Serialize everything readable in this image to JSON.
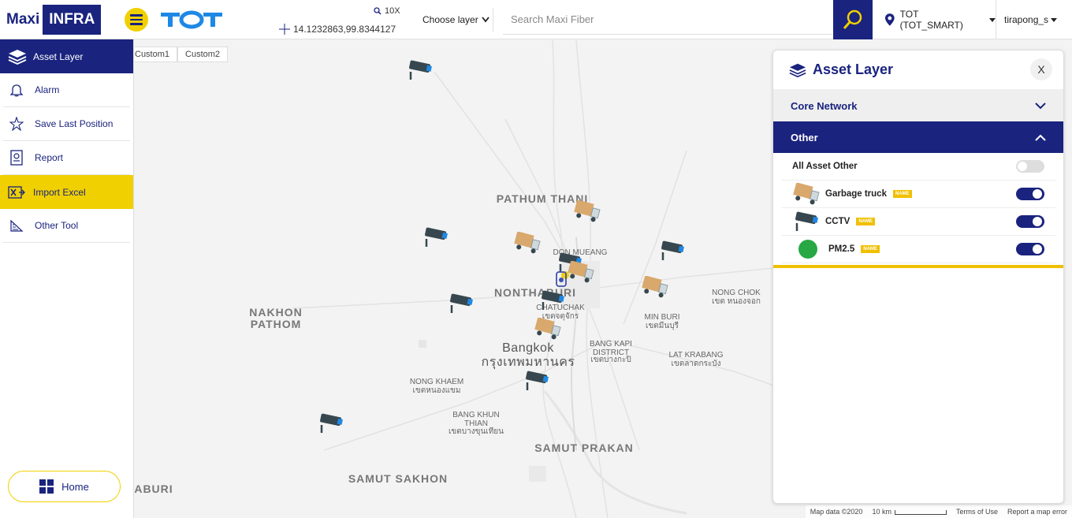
{
  "header": {
    "logo_maxi": "Maxi",
    "logo_infra": "INFRA",
    "zoom": "10X",
    "coordinates": "14.1232863,99.8344127",
    "choose_layer": "Choose layer",
    "search_placeholder": "Search Maxi Fiber",
    "org": "TOT (TOT_SMART)",
    "user": "tirapong_s"
  },
  "sidebar": {
    "items": [
      {
        "label": "Asset Layer",
        "icon": "layers-icon"
      },
      {
        "label": "Alarm",
        "icon": "bell-icon"
      },
      {
        "label": "Save Last Position",
        "icon": "star-icon"
      },
      {
        "label": "Report",
        "icon": "report-icon"
      },
      {
        "label": "Import Excel",
        "icon": "excel-icon"
      },
      {
        "label": "Other Tool",
        "icon": "tool-icon"
      }
    ],
    "home": "Home"
  },
  "map": {
    "tabs": [
      "Custom1",
      "Custom2"
    ],
    "places": {
      "pathum_thani": "PATHUM THANI",
      "don_mueang": "DON MUEANG",
      "nonthaburi": "NONTHABURI",
      "chatuchak": "CHATUCHAK",
      "chatuchak_th": "เขตจตุจักร",
      "nakhon_pathom": "NAKHON PATHOM",
      "nong_chok": "NONG CHOK",
      "nong_chok_th": "เขต หนองจอก",
      "min_buri": "MIN BURI",
      "min_buri_th": "เขตมีนบุรี",
      "bangkok": "Bangkok",
      "bangkok_th": "กรุงเทพมหานคร",
      "bang_kapi": "BANG KAPI DISTRICT",
      "bang_kapi_th": "เขตบางกะปิ",
      "lat_krabang": "LAT KRABANG",
      "lat_krabang_th": "เขตลาดกระบัง",
      "nong_khaem": "NONG KHAEM",
      "nong_khaem_th": "เขตหนองแขม",
      "bang_khun_thian": "BANG KHUN THIAN",
      "bang_khun_thian_th": "เขตบางขุนเทียน",
      "samut_prakan": "SAMUT PRAKAN",
      "samut_sakhon": "SAMUT SAKHON",
      "aburi": "ABURI"
    },
    "footer": {
      "map_data": "Map data ©2020",
      "scale": "10 km",
      "terms": "Terms of Use",
      "report": "Report a map error"
    }
  },
  "panel": {
    "title": "Asset Layer",
    "close": "X",
    "sections": [
      {
        "label": "Core Network",
        "expanded": false
      },
      {
        "label": "Other",
        "expanded": true
      }
    ],
    "all_label": "All Asset Other",
    "all_on": false,
    "layers": [
      {
        "name": "Garbage truck",
        "badge": "NAME",
        "icon": "truck-icon",
        "on": true
      },
      {
        "name": "CCTV",
        "badge": "NAME",
        "icon": "cctv-icon",
        "on": true
      },
      {
        "name": "PM2.5",
        "badge": "NAME",
        "icon": "pm25-dot-icon",
        "on": true
      }
    ]
  },
  "colors": {
    "brand_navy": "#1a237e",
    "brand_yellow": "#f0d000",
    "pm25_green": "#27a844"
  }
}
